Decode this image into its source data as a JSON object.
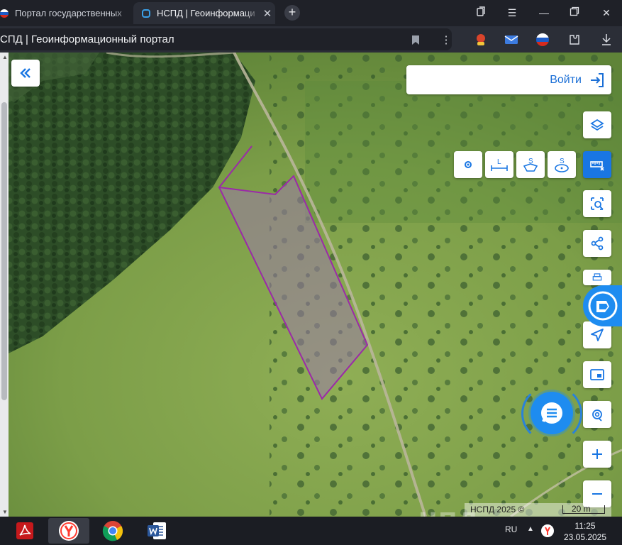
{
  "browser": {
    "tabs": [
      {
        "title": "Портал государственных"
      },
      {
        "title": "НСПД | Геоинформаци"
      }
    ],
    "new_tab_icon": "plus-icon",
    "address_text": "СПД | Геоинформационный портал",
    "window_controls": [
      "bookmarks-icon",
      "menu-icon",
      "minimize-icon",
      "restore-icon",
      "close-icon"
    ]
  },
  "map": {
    "login_label": "Войти",
    "watermark": "цпд",
    "copyright": "НСПД 2025 ©",
    "scale_label": "20 m",
    "measure_tools": [
      {
        "name": "point",
        "label": ""
      },
      {
        "name": "line",
        "label": "L"
      },
      {
        "name": "area-polygon",
        "label": "S"
      },
      {
        "name": "area-circle",
        "label": "S"
      }
    ],
    "toolbar_buttons": [
      "layers-icon",
      "ruler-icon",
      "select-area-icon",
      "share-icon",
      "print-icon",
      "navigate-icon",
      "picture-in-picture-icon",
      "geolocation-icon",
      "zoom-in-icon",
      "zoom-out-icon"
    ],
    "colors": {
      "accent": "#1976e3",
      "parcel_outline": "#9b2aa8",
      "login_text": "#1b6fd6"
    }
  },
  "taskbar": {
    "apps": [
      "acrobat-icon",
      "yandex-browser-icon",
      "chrome-icon",
      "word-icon"
    ],
    "language": "RU",
    "time": "11:25",
    "date": "23.05.2025"
  }
}
